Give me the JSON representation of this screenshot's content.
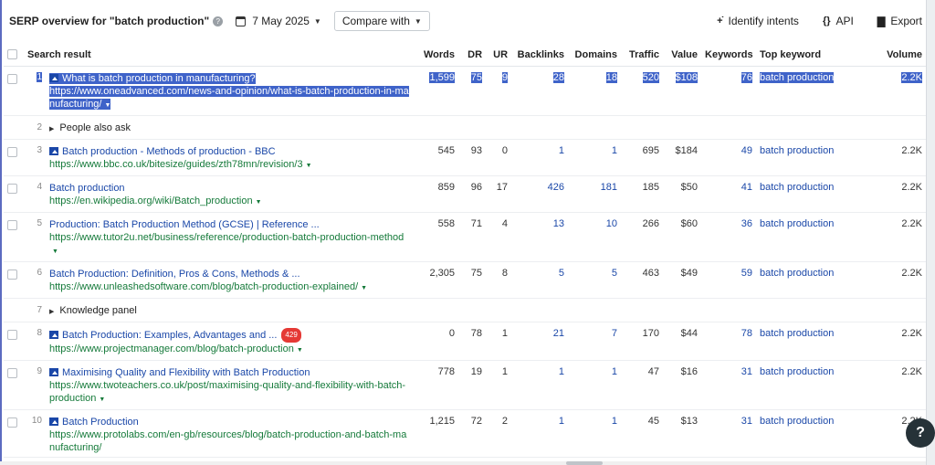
{
  "header": {
    "title": "SERP overview for \"batch production\"",
    "date": "7 May 2025",
    "compare_label": "Compare with",
    "identify_label": "Identify intents",
    "api_label": "API",
    "export_label": "Export",
    "identify_glyph": "+̇",
    "api_glyph": "{}",
    "export_glyph": "▇"
  },
  "columns": {
    "search_result": "Search result",
    "words": "Words",
    "dr": "DR",
    "ur": "UR",
    "backlinks": "Backlinks",
    "domains": "Domains",
    "traffic": "Traffic",
    "value": "Value",
    "keywords": "Keywords",
    "top_keyword": "Top keyword",
    "volume": "Volume"
  },
  "rows": [
    {
      "n": "1",
      "title": "What is batch production in manufacturing?",
      "url": "https://www.oneadvanced.com/news-and-opinion/what-is-batch-production-in-manufacturing/",
      "words": "1,599",
      "dr": "75",
      "ur": "9",
      "backlinks": "28",
      "domains": "18",
      "traffic": "520",
      "value": "$108",
      "keywords": "76",
      "top_keyword": "batch production",
      "volume": "2.2K"
    },
    {
      "n": "2",
      "label": "People also ask"
    },
    {
      "n": "3",
      "title": "Batch production - Methods of production - BBC",
      "url": "https://www.bbc.co.uk/bitesize/guides/zth78mn/revision/3",
      "words": "545",
      "dr": "93",
      "ur": "0",
      "backlinks": "1",
      "domains": "1",
      "traffic": "695",
      "value": "$184",
      "keywords": "49",
      "top_keyword": "batch production",
      "volume": "2.2K"
    },
    {
      "n": "4",
      "title": "Batch production",
      "url": "https://en.wikipedia.org/wiki/Batch_production",
      "words": "859",
      "dr": "96",
      "ur": "17",
      "backlinks": "426",
      "domains": "181",
      "traffic": "185",
      "value": "$50",
      "keywords": "41",
      "top_keyword": "batch production",
      "volume": "2.2K"
    },
    {
      "n": "5",
      "title": "Production: Batch Production Method (GCSE) | Reference ...",
      "url": "https://www.tutor2u.net/business/reference/production-batch-production-method",
      "words": "558",
      "dr": "71",
      "ur": "4",
      "backlinks": "13",
      "domains": "10",
      "traffic": "266",
      "value": "$60",
      "keywords": "36",
      "top_keyword": "batch production",
      "volume": "2.2K"
    },
    {
      "n": "6",
      "title": "Batch Production: Definition, Pros & Cons, Methods & ...",
      "url": "https://www.unleashedsoftware.com/blog/batch-production-explained/",
      "words": "2,305",
      "dr": "75",
      "ur": "8",
      "backlinks": "5",
      "domains": "5",
      "traffic": "463",
      "value": "$49",
      "keywords": "59",
      "top_keyword": "batch production",
      "volume": "2.2K"
    },
    {
      "n": "7",
      "label": "Knowledge panel"
    },
    {
      "n": "8",
      "title": "Batch Production: Examples, Advantages and ...",
      "badge": "429",
      "url": "https://www.projectmanager.com/blog/batch-production",
      "words": "0",
      "dr": "78",
      "ur": "1",
      "backlinks": "21",
      "domains": "7",
      "traffic": "170",
      "value": "$44",
      "keywords": "78",
      "top_keyword": "batch production",
      "volume": "2.2K"
    },
    {
      "n": "9",
      "title": "Maximising Quality and Flexibility with Batch Production",
      "url": "https://www.twoteachers.co.uk/post/maximising-quality-and-flexibility-with-batch-production",
      "words": "778",
      "dr": "19",
      "ur": "1",
      "backlinks": "1",
      "domains": "1",
      "traffic": "47",
      "value": "$16",
      "keywords": "31",
      "top_keyword": "batch production",
      "volume": "2.2K"
    },
    {
      "n": "10",
      "title": "Batch Production",
      "url": "https://www.protolabs.com/en-gb/resources/blog/batch-production-and-batch-manufacturing/",
      "words": "1,215",
      "dr": "72",
      "ur": "2",
      "backlinks": "1",
      "domains": "1",
      "traffic": "45",
      "value": "$13",
      "keywords": "31",
      "top_keyword": "batch production",
      "volume": "2.2K"
    }
  ],
  "help_fab": "?"
}
